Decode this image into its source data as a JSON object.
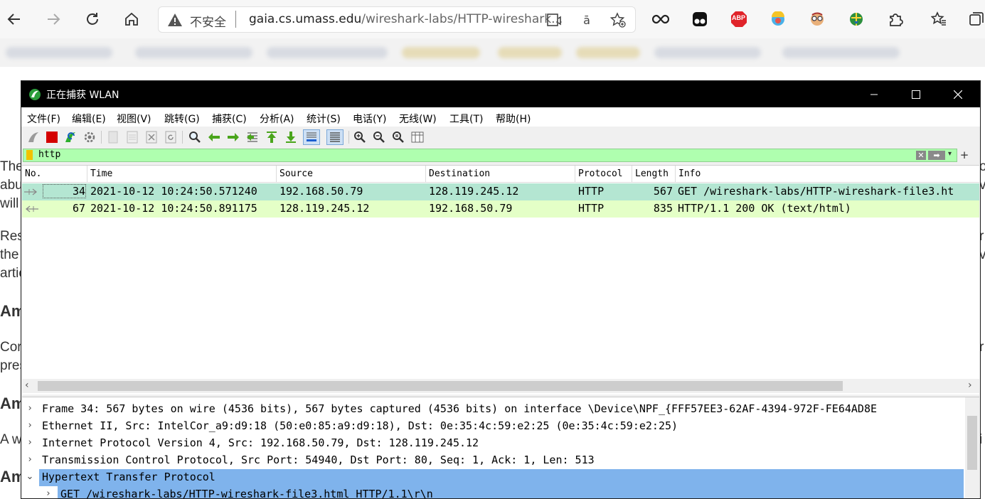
{
  "browser": {
    "address": {
      "insecure_label": "不安全",
      "url_host": "gaia.cs.umass.edu",
      "url_path": "/wireshark-labs/HTTP-wireshark..."
    },
    "extensions": {
      "adblock_label": "ABP"
    }
  },
  "background_page": {
    "left_fragments": [
      "The",
      "abu",
      "will",
      "Res",
      "the",
      "artic",
      "Am",
      "Cor",
      "pres",
      "Am",
      "A w",
      "Am"
    ],
    "right_fragments": [
      "o",
      "v",
      "r",
      "v",
      "r",
      "i"
    ]
  },
  "window": {
    "title": "正在捕获 WLAN"
  },
  "menubar": {
    "items": [
      {
        "label": "文件(F)"
      },
      {
        "label": "编辑(E)"
      },
      {
        "label": "视图(V)"
      },
      {
        "label": "跳转(G)"
      },
      {
        "label": "捕获(C)"
      },
      {
        "label": "分析(A)"
      },
      {
        "label": "统计(S)"
      },
      {
        "label": "电话(Y)"
      },
      {
        "label": "无线(W)"
      },
      {
        "label": "工具(T)"
      },
      {
        "label": "帮助(H)"
      }
    ]
  },
  "filter": {
    "value": "http"
  },
  "packet_list": {
    "columns": [
      "No.",
      "Time",
      "Source",
      "Destination",
      "Protocol",
      "Length",
      "Info"
    ],
    "rows": [
      {
        "no": "34",
        "time": "2021-10-12 10:24:50.571240",
        "source": "192.168.50.79",
        "destination": "128.119.245.12",
        "protocol": "HTTP",
        "length": "567",
        "info": "GET /wireshark-labs/HTTP-wireshark-file3.ht",
        "bg": "#b4e6d2"
      },
      {
        "no": "67",
        "time": "2021-10-12 10:24:50.891175",
        "source": "128.119.245.12",
        "destination": "192.168.50.79",
        "protocol": "HTTP",
        "length": "835",
        "info": "HTTP/1.1 200 OK  (text/html)",
        "bg": "#e4ffc7"
      }
    ]
  },
  "details": {
    "rows": [
      {
        "arrow": "›",
        "text": "Frame 34: 567 bytes on wire (4536 bits), 567 bytes captured (4536 bits) on interface \\Device\\NPF_{FFF57EE3-62AF-4394-972F-FE64AD8E"
      },
      {
        "arrow": "›",
        "text": "Ethernet II, Src: IntelCor_a9:d9:18 (50:e0:85:a9:d9:18), Dst: 0e:35:4c:59:e2:25 (0e:35:4c:59:e2:25)"
      },
      {
        "arrow": "›",
        "text": "Internet Protocol Version 4, Src: 192.168.50.79, Dst: 128.119.245.12"
      },
      {
        "arrow": "›",
        "text": "Transmission Control Protocol, Src Port: 54940, Dst Port: 80, Seq: 1, Ack: 1, Len: 513"
      },
      {
        "arrow": "⌄",
        "text": "Hypertext Transfer Protocol"
      },
      {
        "arrow": "›",
        "text": "GET /wireshark-labs/HTTP-wireshark-file3.html HTTP/1.1\\r\\n"
      }
    ]
  },
  "colors": {
    "filter_bg": "#afffaf",
    "selected_detail": "#7fb3ec",
    "titlebar": "#000000"
  }
}
